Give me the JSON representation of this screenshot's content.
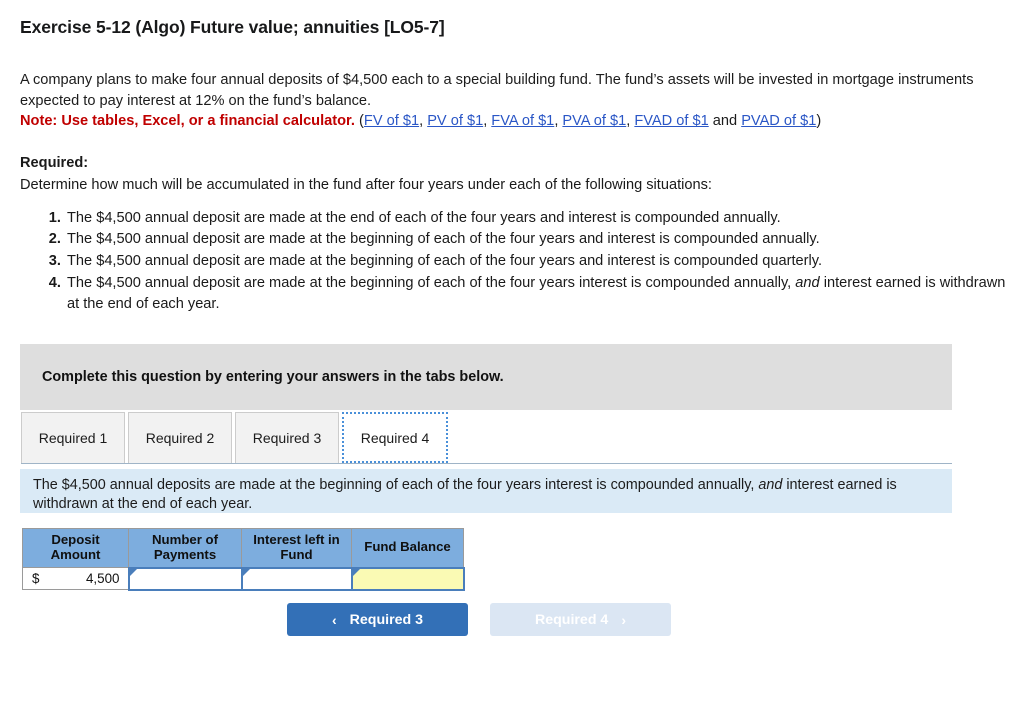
{
  "page_title": "Exercise 5-12 (Algo) Future value; annuities [LO5-7]",
  "problem": {
    "paragraph_part1": "A company plans to make four annual deposits of $4,500 each to a special building fund. The fund’s assets will be invested in mortgage instruments expected to pay interest at 12% on the fund’s balance.",
    "note_label": "Note: Use tables, Excel, or a financial calculator.",
    "paren_open": "(",
    "paren_close": ")",
    "links": [
      {
        "label": "FV of $1",
        "separator": ", "
      },
      {
        "label": "PV of $1",
        "separator": ", "
      },
      {
        "label": "FVA of $1",
        "separator": ", "
      },
      {
        "label": "PVA of $1",
        "separator": ", "
      },
      {
        "label": "FVAD of $1",
        "separator": " and "
      },
      {
        "label": "PVAD of $1",
        "separator": ""
      }
    ]
  },
  "required": {
    "heading": "Required:",
    "intro": "Determine how much will be accumulated in the fund after four years under each of the following situations:",
    "items": [
      "The $4,500 annual deposit are made at the end of each of the four years  and interest is compounded annually.",
      "The $4,500 annual deposit are made at the beginning of each of the four years and interest is compounded annually.",
      "The $4,500 annual deposit are made at the beginning of each of the four years and interest is compounded quarterly.",
      "The $4,500 annual deposit are made at the beginning of each of the four years interest is compounded annually, and interest earned is withdrawn at the end of each year."
    ],
    "item4_pre": "The $4,500 annual deposit are made at the beginning of each of the four years interest is compounded annually, ",
    "item4_italic": "and",
    "item4_post": " interest earned is withdrawn at the end of each year."
  },
  "instruction_banner": {
    "text": "Complete this question by entering your answers in the tabs below."
  },
  "tabs": [
    {
      "label": "Required 1",
      "active": false
    },
    {
      "label": "Required 2",
      "active": false
    },
    {
      "label": "Required 3",
      "active": false
    },
    {
      "label": "Required 4",
      "active": true
    }
  ],
  "info_panel": {
    "pre": "The $4,500 annual deposits are made at the beginning of each of the four years interest is compounded annually, ",
    "italic": "and",
    "post": " interest earned is withdrawn at the end of each year."
  },
  "answer_table": {
    "headers": [
      "Deposit Amount",
      "Number of Payments",
      "Interest left in Fund",
      "Fund Balance"
    ],
    "header_lines": [
      [
        "Deposit",
        "Amount"
      ],
      [
        "Number of",
        "Payments"
      ],
      [
        "Interest left in",
        "Fund"
      ],
      [
        "Fund Balance"
      ]
    ],
    "row": {
      "deposit_symbol": "$",
      "deposit_value": "4,500",
      "number_of_payments": "",
      "interest_left_in_fund": "",
      "fund_balance": ""
    }
  },
  "nav": {
    "prev_label": "Required 3",
    "prev_chevron": "‹",
    "next_label": "Required 4",
    "next_chevron": "›"
  },
  "colors": {
    "accent_blue": "#3370b7",
    "note_red": "#c00000",
    "link_blue": "#2a56c6",
    "table_header_blue": "#7dadde",
    "highlight_yellow": "#fafab4",
    "panel_blue": "#daeaf6",
    "banner_gray": "#dedede"
  }
}
